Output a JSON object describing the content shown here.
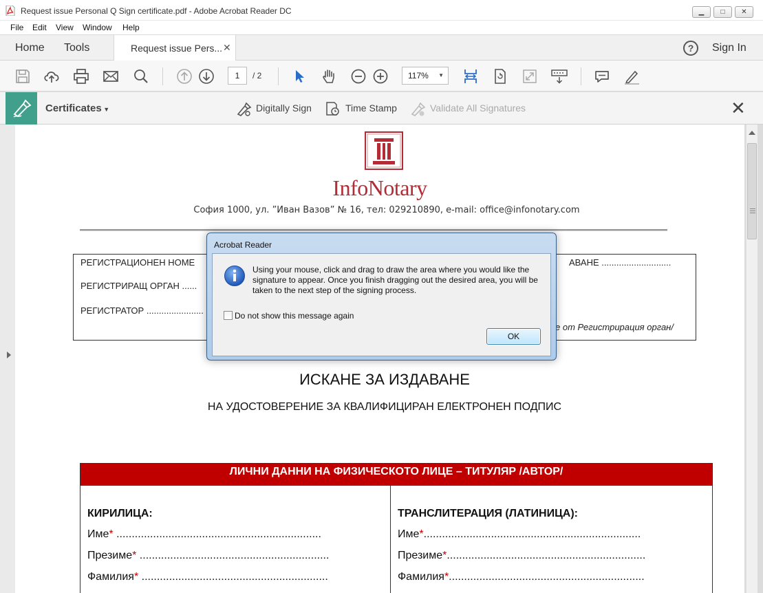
{
  "window": {
    "title": "Request issue Personal Q Sign certificate.pdf - Adobe Acrobat Reader DC",
    "controls": [
      "minimize",
      "maximize",
      "close"
    ]
  },
  "menu": {
    "items": [
      "File",
      "Edit",
      "View",
      "Window",
      "Help"
    ]
  },
  "tabs": {
    "home": "Home",
    "tools": "Tools",
    "document_tab": "Request issue Pers...",
    "close_glyph": "✕",
    "help_glyph": "?",
    "sign_in": "Sign In"
  },
  "toolbar": {
    "page_current": "1",
    "page_total": "/ 2",
    "zoom": "117%"
  },
  "certificates": {
    "title": "Certificates",
    "digitally_sign": "Digitally Sign",
    "time_stamp": "Time Stamp",
    "validate_all": "Validate All Signatures"
  },
  "document": {
    "brand": "InfoNotary",
    "address": "София 1000, ул. ”Иван Вазов” № 16, тел: 029210890, e-mail: office@infonotary.com",
    "reg_number": "РЕГИСТРАЦИОНЕН НОМЕ",
    "reg_body": "РЕГИСТРИРАЩ ОРГАН ......",
    "registrar": "РЕГИСТРАТОР .......................",
    "reg_right": "АВАНЕ ............................",
    "reg_note": "е от Регистрирация орган/",
    "title": "ИСКАНЕ ЗА ИЗДАВАНЕ",
    "subtitle": "НА УДОСТОВЕРЕНИЕ ЗА КВАЛИФИЦИРАН ЕЛЕКТРОНЕН ПОДПИС",
    "form": {
      "header": "ЛИЧНИ ДАННИ НА ФИЗИЧЕСКОТО ЛИЦЕ – ТИТУЛЯР /АВТОР/",
      "left_heading": "КИРИЛИЦА:",
      "right_heading": "ТРАНСЛИТЕРАЦИЯ (ЛАТИНИЦА):",
      "required_mark": "*",
      "left_rows": [
        {
          "label": "Име",
          "dots": " ..................................................................."
        },
        {
          "label": "Презиме",
          "dots": " .............................................................."
        },
        {
          "label": "Фамилия",
          "dots": " ............................................................."
        }
      ],
      "right_rows": [
        {
          "label": "Име",
          "dots": "......................................................................."
        },
        {
          "label": "Презиме",
          "dots": "................................................................."
        },
        {
          "label": "Фамилия",
          "dots": "................................................................"
        }
      ]
    }
  },
  "dialog": {
    "title": "Acrobat Reader",
    "message": "Using your mouse, click and drag to draw the area where you would like the signature to appear. Once you finish dragging out the desired area, you will be taken to the next step of the signing process.",
    "checkbox_label": "Do not show this message again",
    "ok": "OK"
  },
  "colors": {
    "accent_green": "#41a08b",
    "brand_red": "#b32b35",
    "form_header_red": "#c00000",
    "toolbar_blue": "#2b6cc4"
  }
}
